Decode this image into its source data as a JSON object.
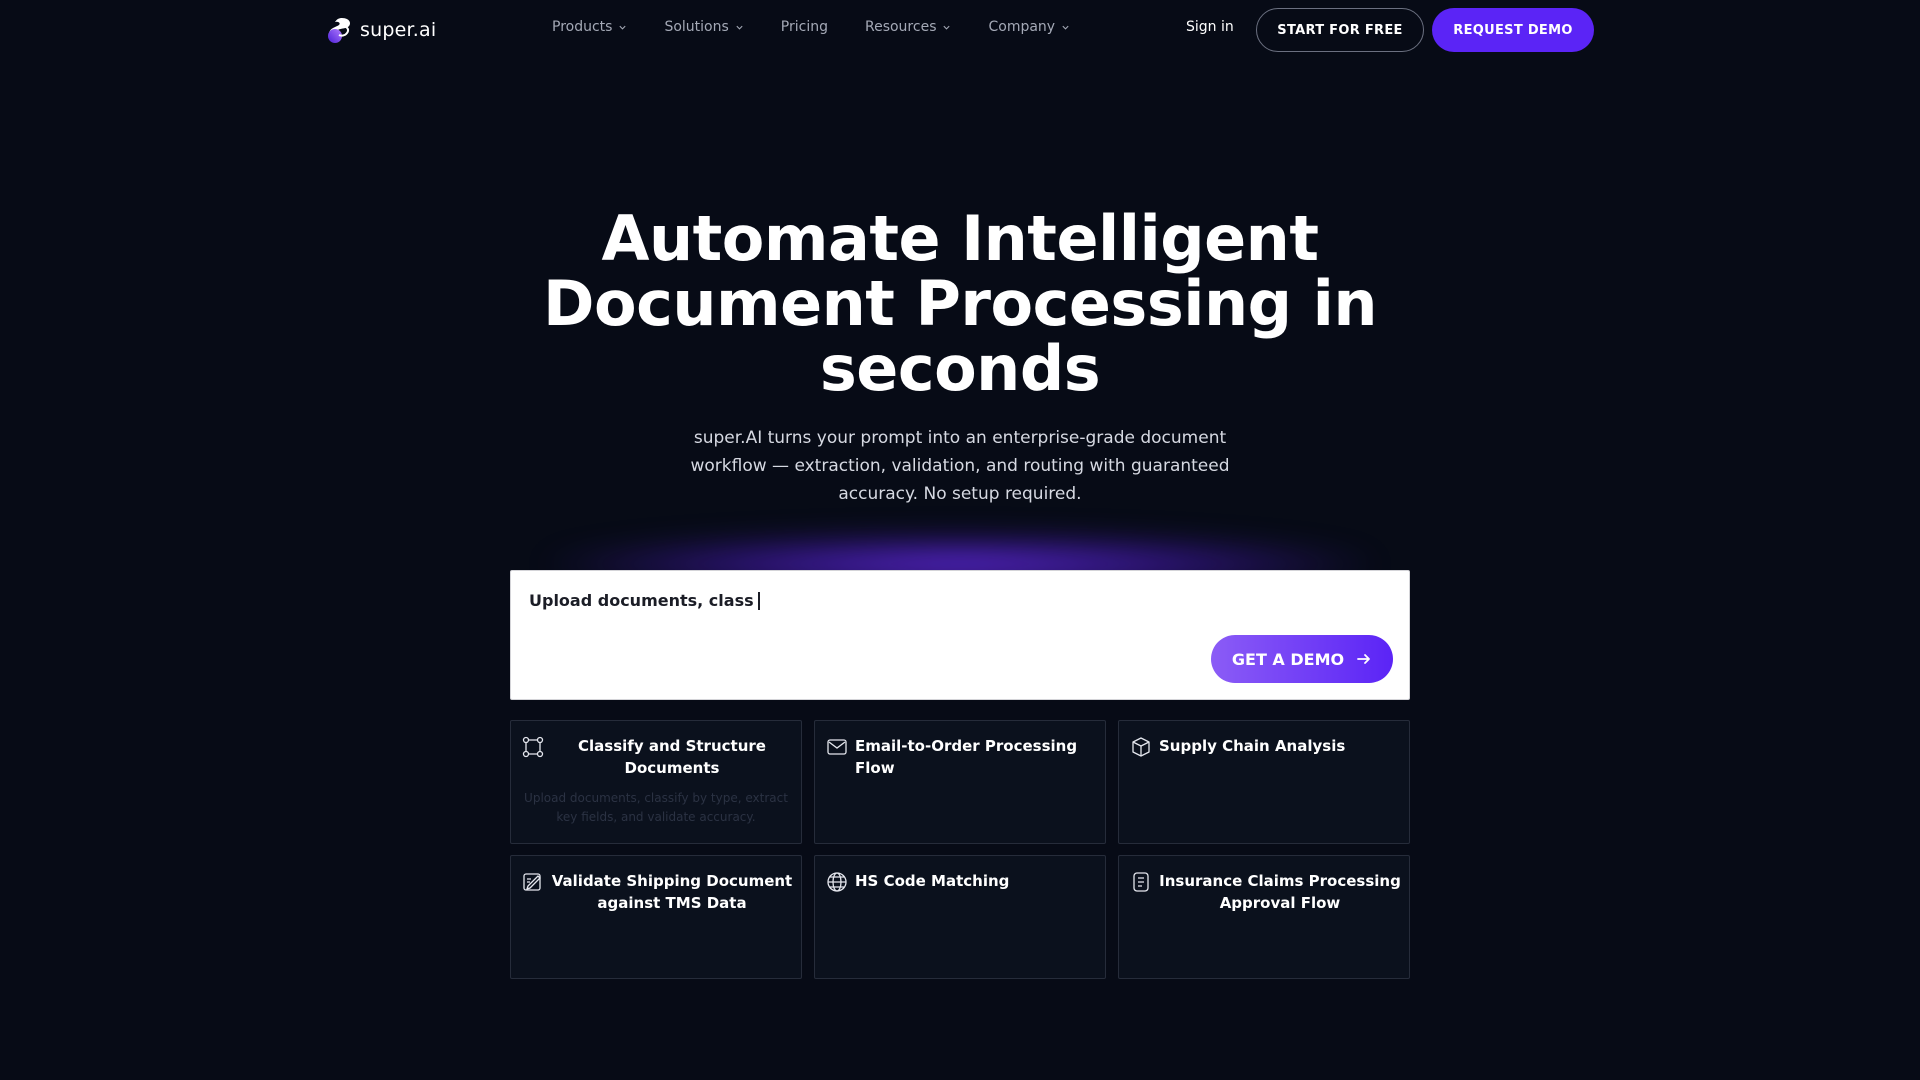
{
  "nav": {
    "logo_text": "super.ai",
    "menu": [
      {
        "label": "Products",
        "dropdown": true
      },
      {
        "label": "Solutions",
        "dropdown": true
      },
      {
        "label": "Pricing",
        "dropdown": false
      },
      {
        "label": "Resources",
        "dropdown": true
      },
      {
        "label": "Company",
        "dropdown": true
      }
    ],
    "sign_in": "Sign in",
    "start_free": "START FOR FREE",
    "request_demo": "REQUEST DEMO"
  },
  "hero": {
    "title": "Automate Intelligent Document Processing in seconds",
    "subtitle": "super.AI turns your prompt into an enterprise-grade document workflow — extraction, validation, and routing with guaranteed accuracy. No setup required."
  },
  "prompt": {
    "typed_text": "Upload documents, class",
    "button_label": "GET A DEMO"
  },
  "cards": [
    {
      "title": "Classify and Structure Documents",
      "description": "Upload documents, classify by type, extract key fields, and validate accuracy.",
      "icon": "nodes-icon"
    },
    {
      "title": "Email-to-Order Processing Flow",
      "description": "",
      "icon": "mail-icon"
    },
    {
      "title": "Supply Chain Analysis",
      "description": "",
      "icon": "box-icon"
    },
    {
      "title": "Validate Shipping Document against TMS Data",
      "description": "",
      "icon": "doc-edit-icon"
    },
    {
      "title": "HS Code Matching",
      "description": "",
      "icon": "globe-icon"
    },
    {
      "title": "Insurance Claims Processing Approval Flow",
      "description": "",
      "icon": "clipboard-icon"
    }
  ],
  "colors": {
    "background": "#070b16",
    "accent": "#5b24f6",
    "card_bg": "#0b111d",
    "card_border": "#262c3a"
  }
}
